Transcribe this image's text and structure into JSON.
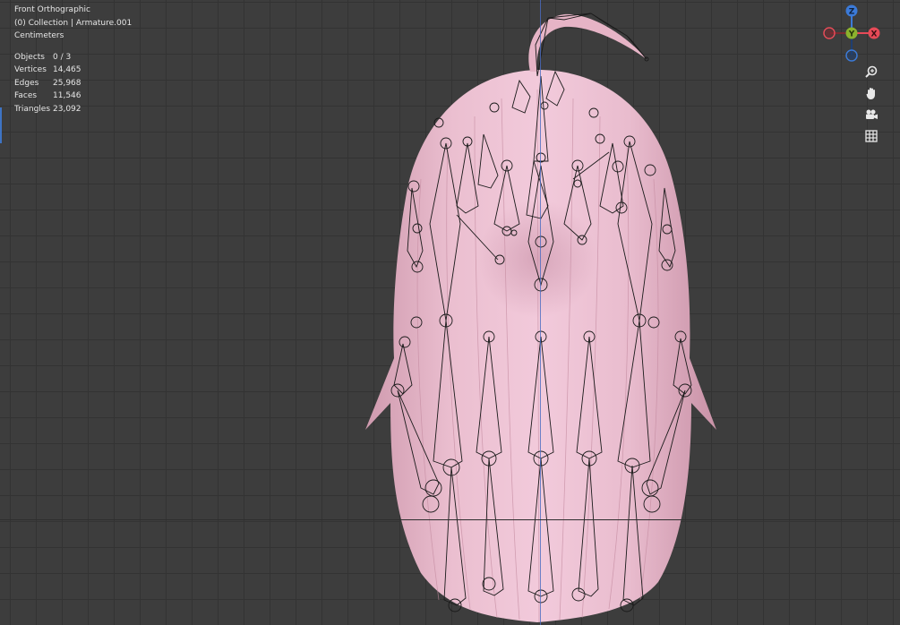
{
  "viewport": {
    "view_name": "Front Orthographic",
    "collection": "(0) Collection | Armature.001",
    "units": "Centimeters",
    "stats": [
      {
        "label": "Objects",
        "value": "0 / 3"
      },
      {
        "label": "Vertices",
        "value": "14,465"
      },
      {
        "label": "Edges",
        "value": "25,968"
      },
      {
        "label": "Faces",
        "value": "11,546"
      },
      {
        "label": "Triangles",
        "value": "23,092"
      }
    ]
  },
  "gizmo": {
    "z_label": "Z",
    "y_label": "Y",
    "x_label": "X",
    "colors": {
      "x": "#e64a57",
      "y": "#8bb22d",
      "z": "#3b7ad8"
    }
  },
  "nav_tools": [
    {
      "name": "zoom-icon",
      "glyph": "⌕"
    },
    {
      "name": "pan-hand-icon",
      "glyph": "✋"
    },
    {
      "name": "camera-icon",
      "glyph": "🎥"
    },
    {
      "name": "grid-icon",
      "glyph": "▦"
    }
  ],
  "colors": {
    "background": "#3d3d3d",
    "hair": "#e8b8cc",
    "bone_outline": "#1a1a1a"
  }
}
